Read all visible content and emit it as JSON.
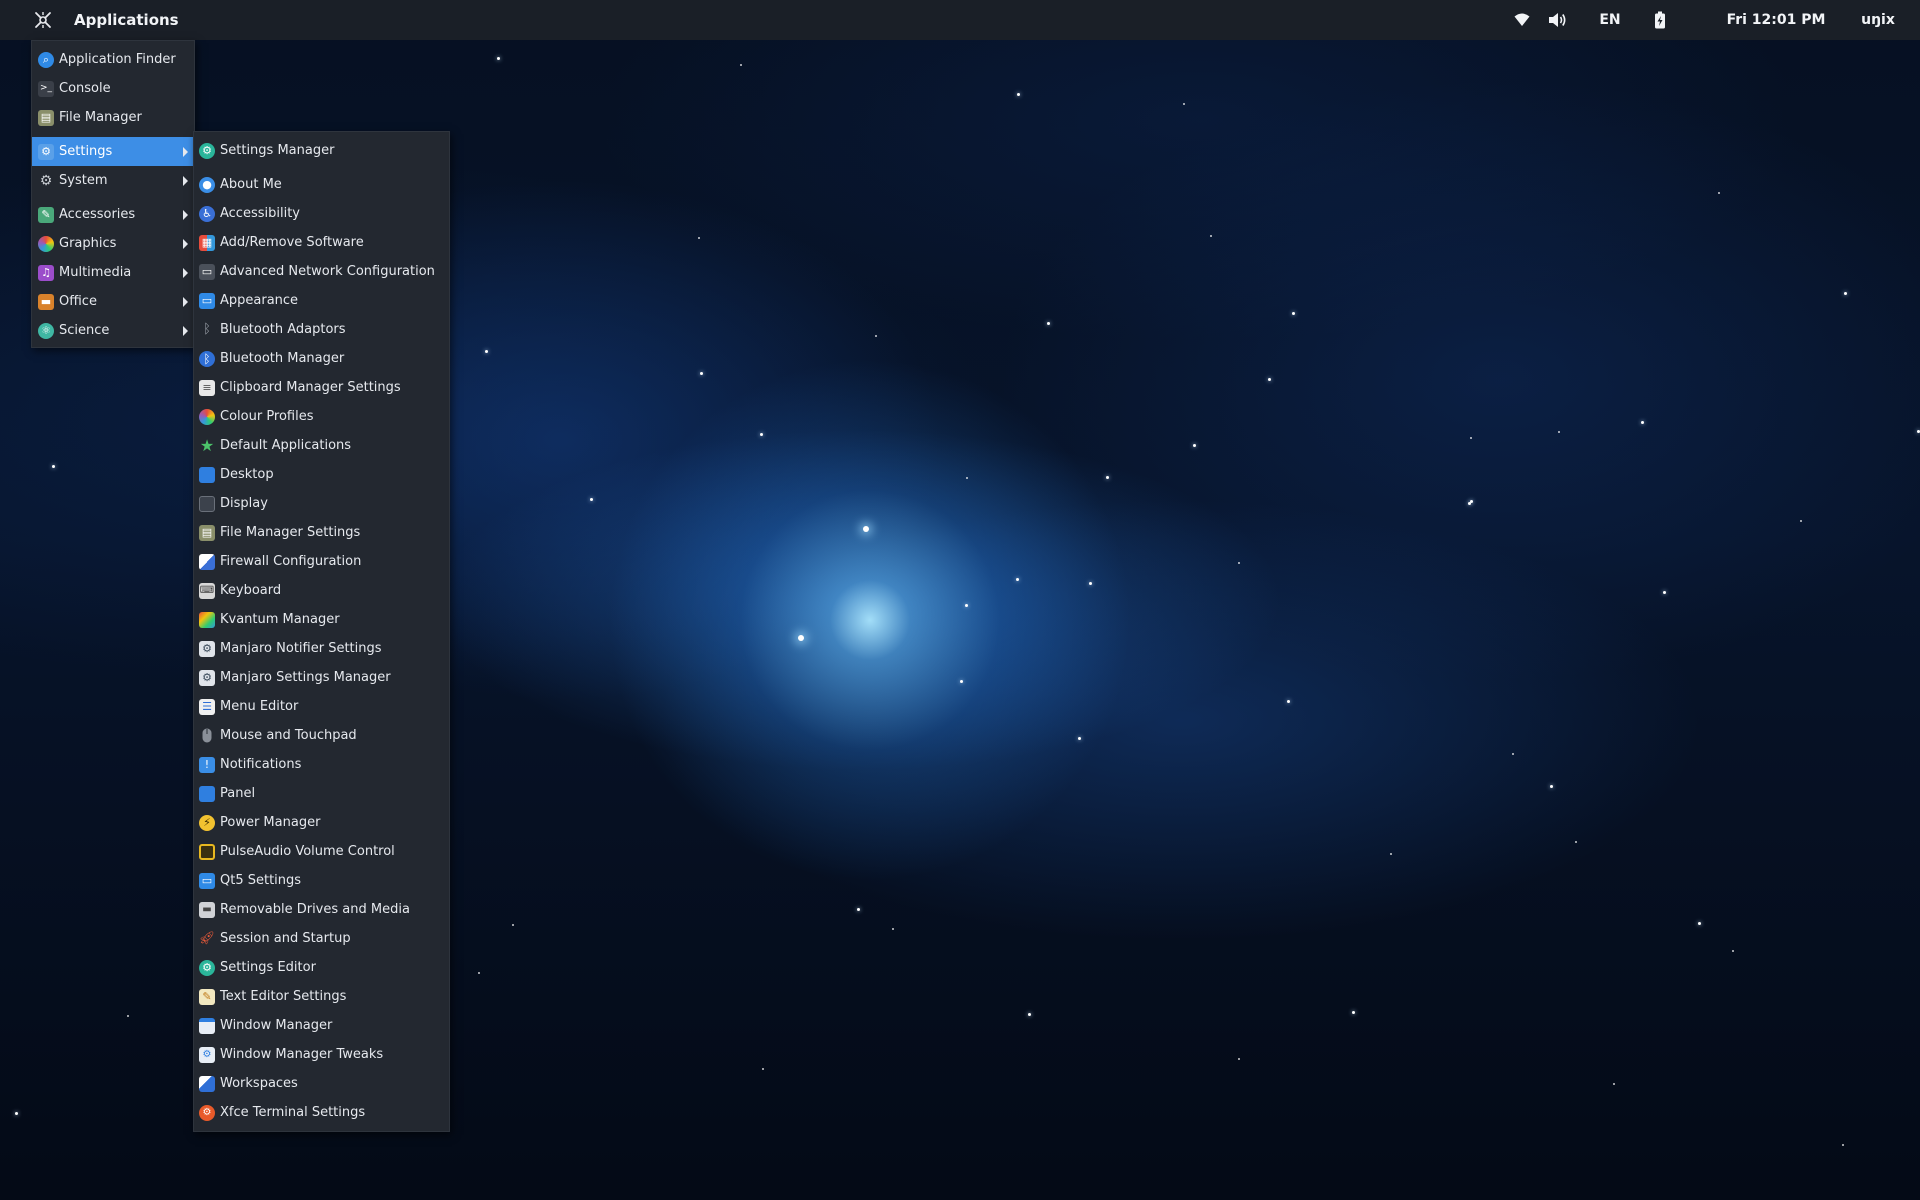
{
  "panel": {
    "apps_label": "Applications",
    "apps_icon": "app-menu-logo-icon",
    "tray": {
      "wifi_icon": "wifi-icon",
      "volume_icon": "volume-icon",
      "language": "EN",
      "battery_icon": "battery-charging-icon",
      "clock": "Fri 12:01 PM",
      "user": "uŋix"
    },
    "colors": {
      "background": "#1a1f27",
      "text": "#f2f4f7"
    }
  },
  "main_menu": {
    "items": [
      {
        "label": "Application Finder",
        "icon": "search-icon"
      },
      {
        "label": "Console",
        "icon": "terminal-icon"
      },
      {
        "label": "File Manager",
        "icon": "file-cabinet-icon"
      },
      {
        "label": "Settings",
        "icon": "settings-icon",
        "submenu": true,
        "active": true
      },
      {
        "label": "System",
        "icon": "gear-icon",
        "submenu": true
      },
      {
        "label": "Accessories",
        "icon": "accessories-icon",
        "submenu": true
      },
      {
        "label": "Graphics",
        "icon": "graphics-icon",
        "submenu": true
      },
      {
        "label": "Multimedia",
        "icon": "multimedia-icon",
        "submenu": true
      },
      {
        "label": "Office",
        "icon": "briefcase-icon",
        "submenu": true
      },
      {
        "label": "Science",
        "icon": "science-icon",
        "submenu": true
      }
    ],
    "highlight_color": "#3d8ee6"
  },
  "settings_menu": {
    "items": [
      {
        "label": "Settings Manager",
        "icon": "settings-manager-icon"
      },
      {
        "label": "About Me",
        "icon": "user-icon"
      },
      {
        "label": "Accessibility",
        "icon": "accessibility-icon"
      },
      {
        "label": "Add/Remove Software",
        "icon": "software-icon"
      },
      {
        "label": "Advanced Network Configuration",
        "icon": "network-icon"
      },
      {
        "label": "Appearance",
        "icon": "appearance-icon"
      },
      {
        "label": "Bluetooth Adaptors",
        "icon": "bluetooth-icon"
      },
      {
        "label": "Bluetooth Manager",
        "icon": "bluetooth-icon"
      },
      {
        "label": "Clipboard Manager Settings",
        "icon": "clipboard-icon"
      },
      {
        "label": "Colour Profiles",
        "icon": "color-profile-icon"
      },
      {
        "label": "Default Applications",
        "icon": "star-icon"
      },
      {
        "label": "Desktop",
        "icon": "desktop-icon"
      },
      {
        "label": "Display",
        "icon": "display-icon"
      },
      {
        "label": "File Manager Settings",
        "icon": "file-cabinet-icon"
      },
      {
        "label": "Firewall Configuration",
        "icon": "firewall-icon"
      },
      {
        "label": "Keyboard",
        "icon": "keyboard-icon"
      },
      {
        "label": "Kvantum Manager",
        "icon": "kvantum-icon"
      },
      {
        "label": "Manjaro Notifier Settings",
        "icon": "manjaro-icon"
      },
      {
        "label": "Manjaro Settings Manager",
        "icon": "manjaro-icon"
      },
      {
        "label": "Menu Editor",
        "icon": "menu-editor-icon"
      },
      {
        "label": "Mouse and Touchpad",
        "icon": "mouse-icon"
      },
      {
        "label": "Notifications",
        "icon": "notification-icon"
      },
      {
        "label": "Panel",
        "icon": "panel-icon"
      },
      {
        "label": "Power Manager",
        "icon": "power-icon"
      },
      {
        "label": "PulseAudio Volume Control",
        "icon": "speaker-icon"
      },
      {
        "label": "Qt5 Settings",
        "icon": "qt-icon"
      },
      {
        "label": "Removable Drives and Media",
        "icon": "drive-icon"
      },
      {
        "label": "Session and Startup",
        "icon": "rocket-icon"
      },
      {
        "label": "Settings Editor",
        "icon": "settings-editor-icon"
      },
      {
        "label": "Text Editor Settings",
        "icon": "pencil-icon"
      },
      {
        "label": "Window Manager",
        "icon": "window-icon"
      },
      {
        "label": "Window Manager Tweaks",
        "icon": "window-tweaks-icon"
      },
      {
        "label": "Workspaces",
        "icon": "workspaces-icon"
      },
      {
        "label": "Xfce Terminal Settings",
        "icon": "terminal-settings-icon"
      }
    ]
  }
}
